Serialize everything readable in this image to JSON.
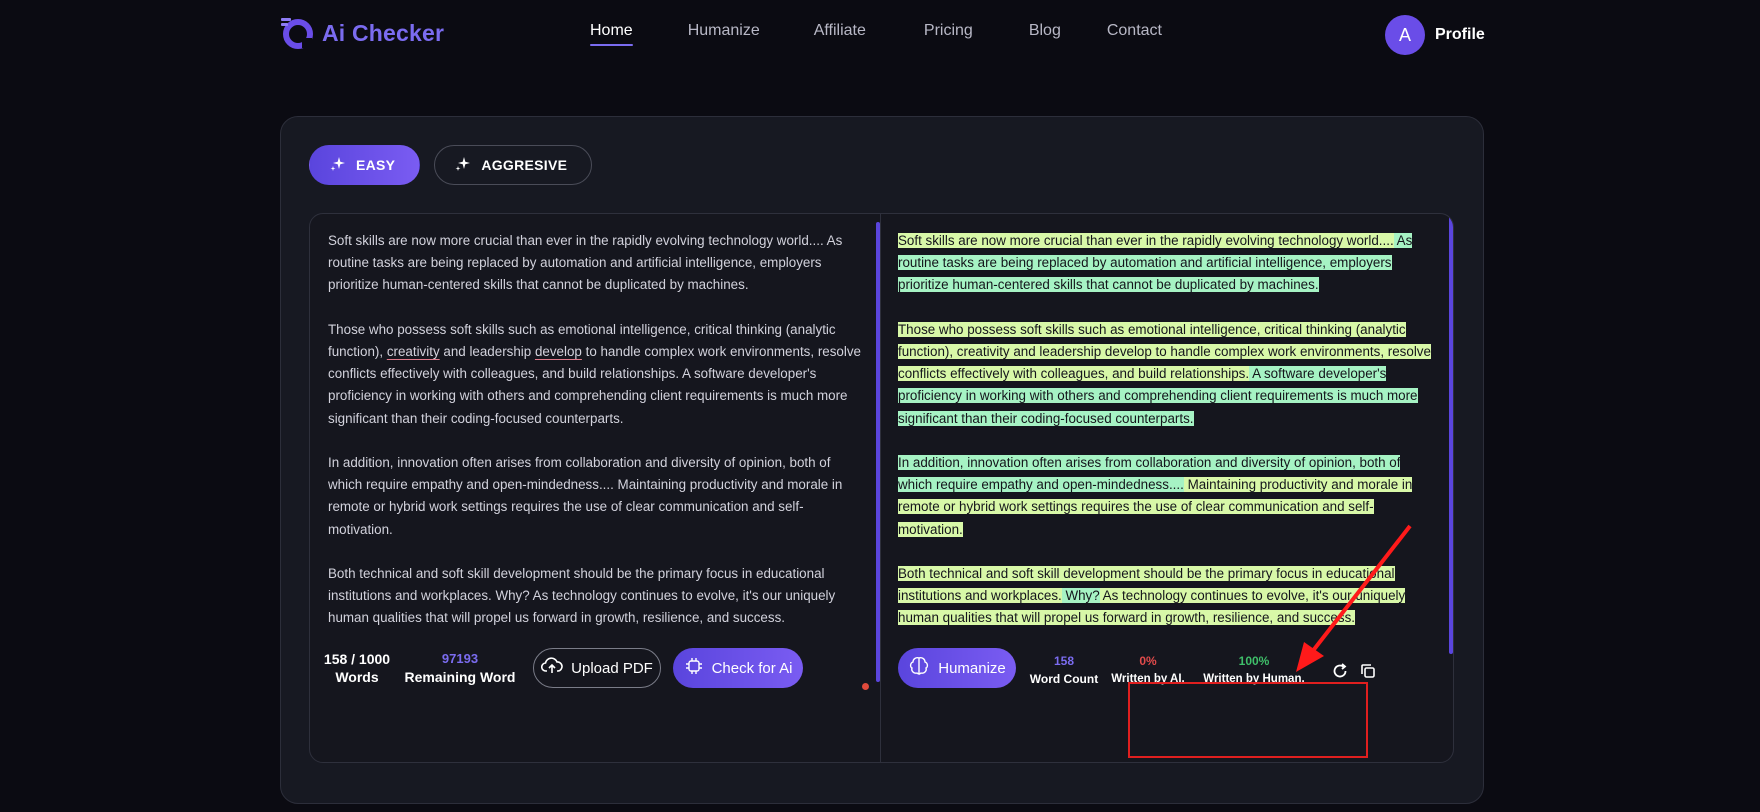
{
  "app": {
    "brand": "Ai Checker"
  },
  "nav": {
    "items": [
      {
        "label": "Home",
        "active": true
      },
      {
        "label": "Humanize"
      },
      {
        "label": "Affiliate"
      },
      {
        "label": "Pricing"
      },
      {
        "label": "Blog"
      },
      {
        "label": "Contact"
      }
    ],
    "profile": {
      "initial": "A",
      "label": "Profile"
    }
  },
  "modes": {
    "easy": "EASY",
    "aggressive": "AGGRESIVE",
    "active": "EASY"
  },
  "input": {
    "paragraphs": [
      "Soft skills are now more crucial than ever in the rapidly evolving technology world.... As routine tasks are being replaced by automation and artificial intelligence, employers prioritize human-centered skills that cannot be duplicated by machines.",
      "Those who possess soft skills such as emotional intelligence, critical thinking (analytic function), creativity and leadership develop to handle complex work environments, resolve conflicts effectively with colleagues, and build relationships. A software developer's proficiency in working with others and comprehending client requirements is much more significant than their coding-focused counterparts.",
      "In addition, innovation often arises from collaboration and diversity of opinion, both of which require empathy and open-mindedness.... Maintaining productivity and morale in remote or hybrid work settings requires the use of clear communication and self-motivation.",
      "Both technical and soft skill development should be the primary focus in educational institutions and workplaces. Why? As technology continues to evolve, it's our uniquely human qualities that will propel us forward in growth, resilience, and success."
    ],
    "p2": {
      "before": "Those who possess soft skills such as emotional intelligence, critical thinking (analytic function), ",
      "u1": "creativity",
      "mid": " and leadership ",
      "u2": "develop",
      "after": " to handle complex work environments, resolve conflicts effectively with colleagues, and build relationships. A software developer's proficiency in working with others and comprehending client requirements is much more significant than their coding-focused counterparts."
    },
    "word_count": "158 / 1000",
    "word_label": "Words",
    "remaining": "97193",
    "remaining_label": "Remaining Word",
    "upload_label": "Upload PDF",
    "check_label": "Check for Ai"
  },
  "output": {
    "p1a": "Soft skills are now more crucial than ever in the rapidly evolving technology world....",
    "p1b": " As routine tasks are being replaced by automation and artificial intelligence, employers prioritize human-centered skills that cannot be duplicated by machines.",
    "p2a": "Those who possess soft skills such as emotional intelligence, critical thinking (analytic function), creativity and leadership develop to handle complex work environments, resolve conflicts effectively with colleagues, and build relationships.",
    "p2b": " A software developer's proficiency in working with others and comprehending client requirements is much more significant than their coding-focused counterparts.",
    "p3a": "In addition, innovation often arises from collaboration and diversity of opinion, both of which require empathy and open-mindedness....",
    "p3b": " Maintaining productivity and morale in remote or hybrid work settings requires the use of clear communication and self-motivation.",
    "p4a": "Both technical and soft skill development should be the primary focus in educational institutions and workplaces.",
    "p4b": " Why?",
    "p4c": " As technology continues to evolve, it's our uniquely human qualities that will propel us forward in growth, resilience, and success.",
    "humanize_label": "Humanize",
    "word_count": "158",
    "word_count_label": "Word Count",
    "ai_percent": "0%",
    "ai_label": "Written by AI.",
    "human_percent": "100%",
    "human_label": "Written by Human."
  },
  "colors": {
    "accent": "#6a4de8",
    "highlight_green": "#a6f3c4",
    "highlight_yellow": "#d8f8a8",
    "ai_red": "#e24b4b",
    "human_green": "#3fbf6a",
    "annotation_red": "#e01f1f"
  },
  "icons": {
    "mode": "sparkle-icon",
    "upload": "cloud-upload-icon",
    "check": "chip-icon",
    "humanize": "brain-icon",
    "refresh": "refresh-icon",
    "copy": "copy-icon"
  }
}
